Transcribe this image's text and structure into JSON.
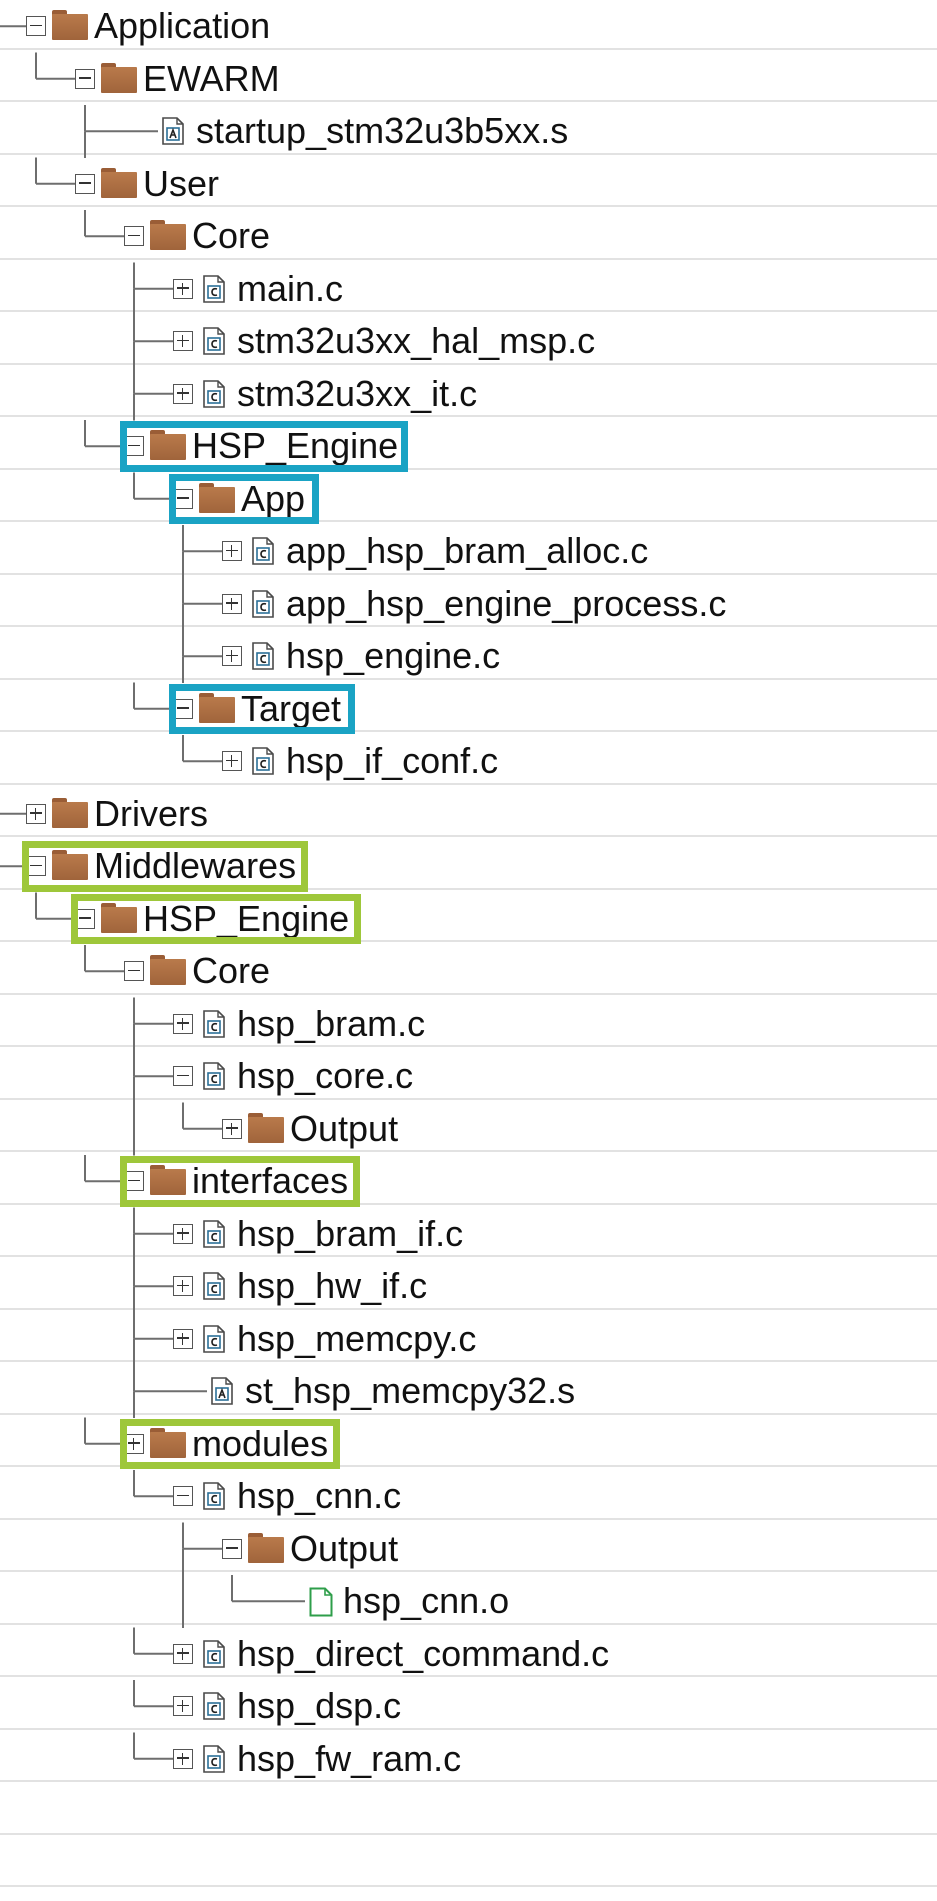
{
  "tree": {
    "nodes": [
      {
        "label": "Application",
        "type": "folder",
        "depth": 1,
        "toggle": "minus",
        "lines": [
          false,
          false
        ]
      },
      {
        "label": "EWARM",
        "type": "folder",
        "depth": 2,
        "toggle": "minus",
        "lines": [
          true,
          false,
          true
        ]
      },
      {
        "label": "startup_stm32u3b5xx.s",
        "type": "asm-file",
        "depth": 3,
        "toggle": "none",
        "lines": [
          true,
          false,
          true,
          false
        ]
      },
      {
        "label": "User",
        "type": "folder",
        "depth": 2,
        "toggle": "minus",
        "lines": [
          true,
          false,
          false
        ]
      },
      {
        "label": "Core",
        "type": "folder",
        "depth": 3,
        "toggle": "minus",
        "lines": [
          true,
          false,
          false,
          true
        ]
      },
      {
        "label": "main.c",
        "type": "c-file",
        "depth": 4,
        "toggle": "plus",
        "lines": [
          true,
          false,
          false,
          true,
          true
        ]
      },
      {
        "label": "stm32u3xx_hal_msp.c",
        "type": "c-file",
        "depth": 4,
        "toggle": "plus",
        "lines": [
          true,
          false,
          false,
          true,
          true
        ]
      },
      {
        "label": "stm32u3xx_it.c",
        "type": "c-file",
        "depth": 4,
        "toggle": "plus",
        "lines": [
          true,
          false,
          false,
          true,
          false
        ]
      },
      {
        "label": "HSP_Engine",
        "type": "folder",
        "depth": 3,
        "toggle": "minus",
        "lines": [
          true,
          false,
          false,
          false
        ]
      },
      {
        "label": "App",
        "type": "folder",
        "depth": 4,
        "toggle": "minus",
        "lines": [
          true,
          false,
          false,
          false,
          true
        ]
      },
      {
        "label": "app_hsp_bram_alloc.c",
        "type": "c-file",
        "depth": 5,
        "toggle": "plus",
        "lines": [
          true,
          false,
          false,
          false,
          true,
          true
        ]
      },
      {
        "label": "app_hsp_engine_process.c",
        "type": "c-file",
        "depth": 5,
        "toggle": "plus",
        "lines": [
          true,
          false,
          false,
          false,
          true,
          true
        ]
      },
      {
        "label": "hsp_engine.c",
        "type": "c-file",
        "depth": 5,
        "toggle": "plus",
        "lines": [
          true,
          false,
          false,
          false,
          true,
          false
        ]
      },
      {
        "label": "Target",
        "type": "folder",
        "depth": 4,
        "toggle": "minus",
        "lines": [
          true,
          false,
          false,
          false,
          false
        ]
      },
      {
        "label": "hsp_if_conf.c",
        "type": "c-file",
        "depth": 5,
        "toggle": "plus",
        "lines": [
          true,
          false,
          false,
          false,
          false,
          false
        ]
      },
      {
        "label": "Drivers",
        "type": "folder",
        "depth": 1,
        "toggle": "plus",
        "lines": [
          true,
          true
        ]
      },
      {
        "label": "Middlewares",
        "type": "folder",
        "depth": 1,
        "toggle": "minus",
        "lines": [
          true,
          false
        ]
      },
      {
        "label": "HSP_Engine",
        "type": "folder",
        "depth": 2,
        "toggle": "minus",
        "lines": [
          false,
          false,
          false
        ]
      },
      {
        "label": "Core",
        "type": "folder",
        "depth": 3,
        "toggle": "minus",
        "lines": [
          false,
          false,
          false,
          true
        ]
      },
      {
        "label": "hsp_bram.c",
        "type": "c-file",
        "depth": 4,
        "toggle": "plus",
        "lines": [
          false,
          false,
          false,
          true,
          true
        ]
      },
      {
        "label": "hsp_core.c",
        "type": "c-file",
        "depth": 4,
        "toggle": "minus",
        "lines": [
          false,
          false,
          false,
          true,
          false
        ]
      },
      {
        "label": "Output",
        "type": "folder",
        "depth": 5,
        "toggle": "plus",
        "lines": [
          false,
          false,
          false,
          true,
          false,
          false
        ]
      },
      {
        "label": "interfaces",
        "type": "folder",
        "depth": 3,
        "toggle": "minus",
        "lines": [
          false,
          false,
          false,
          true
        ]
      },
      {
        "label": "hsp_bram_if.c",
        "type": "c-file",
        "depth": 4,
        "toggle": "plus",
        "lines": [
          false,
          false,
          false,
          true,
          true
        ]
      },
      {
        "label": "hsp_hw_if.c",
        "type": "c-file",
        "depth": 4,
        "toggle": "plus",
        "lines": [
          false,
          false,
          false,
          true,
          true
        ]
      },
      {
        "label": "hsp_memcpy.c",
        "type": "c-file",
        "depth": 4,
        "toggle": "plus",
        "lines": [
          false,
          false,
          false,
          true,
          true
        ]
      },
      {
        "label": "st_hsp_memcpy32.s",
        "type": "asm-file",
        "depth": 4,
        "toggle": "none",
        "lines": [
          false,
          false,
          false,
          true,
          false
        ]
      },
      {
        "label": "modules",
        "type": "folder",
        "depth": 3,
        "toggle": "plus",
        "lines": [
          false,
          false,
          false,
          false
        ]
      },
      {
        "label": "hsp_cnn.c",
        "type": "c-file",
        "depth": 4,
        "toggle": "minus",
        "lines": [
          false,
          false,
          false,
          false,
          true
        ]
      },
      {
        "label": "Output",
        "type": "folder",
        "depth": 5,
        "toggle": "minus",
        "lines": [
          false,
          false,
          false,
          false,
          true,
          false
        ]
      },
      {
        "label": "hsp_cnn.o",
        "type": "obj-file",
        "depth": 6,
        "toggle": "none",
        "lines": [
          false,
          false,
          false,
          false,
          true,
          false,
          false
        ]
      },
      {
        "label": "hsp_direct_command.c",
        "type": "c-file",
        "depth": 4,
        "toggle": "plus",
        "lines": [
          false,
          false,
          false,
          false,
          true
        ]
      },
      {
        "label": "hsp_dsp.c",
        "type": "c-file",
        "depth": 4,
        "toggle": "plus",
        "lines": [
          false,
          false,
          false,
          false,
          true
        ]
      },
      {
        "label": "hsp_fw_ram.c",
        "type": "c-file",
        "depth": 4,
        "toggle": "plus",
        "lines": [
          false,
          false,
          false,
          false,
          false
        ]
      }
    ]
  },
  "highlights": [
    {
      "row": 8,
      "color": "#1aa3c4",
      "extend": 4,
      "group": "user"
    },
    {
      "row": 9,
      "color": "#1aa3c4",
      "extend": 8,
      "group": "user"
    },
    {
      "row": 13,
      "color": "#1aa3c4",
      "extend": 8,
      "group": "user"
    },
    {
      "row": 16,
      "color": "#9ec73a",
      "extend": 6,
      "group": "middleware"
    },
    {
      "row": 17,
      "color": "#9ec73a",
      "extend": 6,
      "group": "middleware"
    },
    {
      "row": 22,
      "color": "#9ec73a",
      "extend": 6,
      "group": "middleware"
    },
    {
      "row": 27,
      "color": "#9ec73a",
      "extend": 6,
      "group": "middleware"
    }
  ],
  "colors": {
    "row_line": "#e2e2e2",
    "tree_line": "#6e6e6e",
    "folder": "#a8693f",
    "c_file_badge": "#2b6f97",
    "asm_file_badge": "#2b6f97",
    "obj_file": "#2e9e4a"
  },
  "icons": {
    "folder": "folder-icon",
    "c-file": "c-source-file-icon",
    "asm-file": "assembly-file-icon",
    "obj-file": "object-file-icon",
    "toggle-minus": "collapse-toggle-icon",
    "toggle-plus": "expand-toggle-icon"
  }
}
